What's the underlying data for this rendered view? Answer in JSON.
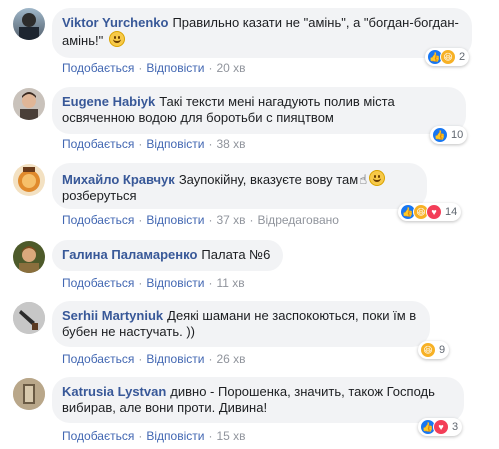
{
  "comments": [
    {
      "author": "Viktor Yurchenko",
      "text": "Правильно казати не \"амінь\", а \"богдан-богдан-амінь!\"",
      "like_label": "Подобається",
      "reply_label": "Відповісти",
      "time": "20 хв",
      "reaction_count": "2",
      "reactions": [
        "like-icon",
        "haha-icon"
      ]
    },
    {
      "author": "Eugene Habiyk",
      "text": "Такі тексти мені нагадують полив міста освяченною водою для боротьби с пияцтвом",
      "like_label": "Подобається",
      "reply_label": "Відповісти",
      "time": "38 хв",
      "reaction_count": "10",
      "reactions": [
        "like-icon"
      ]
    },
    {
      "author": "Михайло Кравчук",
      "text": "Заупокійну, вказуєте вову там",
      "text2": "розберуться",
      "like_label": "Подобається",
      "reply_label": "Відповісти",
      "time": "37 хв",
      "edited": "Відредаговано",
      "reaction_count": "14",
      "reactions": [
        "like-icon",
        "haha-icon",
        "love-icon"
      ]
    },
    {
      "author": "Галина Паламаренко",
      "text": "Палата №6",
      "like_label": "Подобається",
      "reply_label": "Відповісти",
      "time": "11 хв"
    },
    {
      "author": "Serhii Martyniuk",
      "text": "Деякі шамани не заспокоються, поки їм в бубен не настучать. ))",
      "like_label": "Подобається",
      "reply_label": "Відповісти",
      "time": "26 хв",
      "reaction_count": "9",
      "reactions": [
        "haha-icon"
      ]
    },
    {
      "author": "Katrusia Lystvan",
      "text": "дивно - Порошенка, значить, також Господь вибирав, але вони проти. Дивина!",
      "like_label": "Подобається",
      "reply_label": "Відповісти",
      "time": "15 хв",
      "reaction_count": "3",
      "reactions": [
        "like-icon",
        "love-icon"
      ]
    }
  ],
  "colors": {
    "author": "#385898",
    "link": "#4267b2",
    "bubble": "#f2f3f5",
    "meta": "#90949c"
  }
}
